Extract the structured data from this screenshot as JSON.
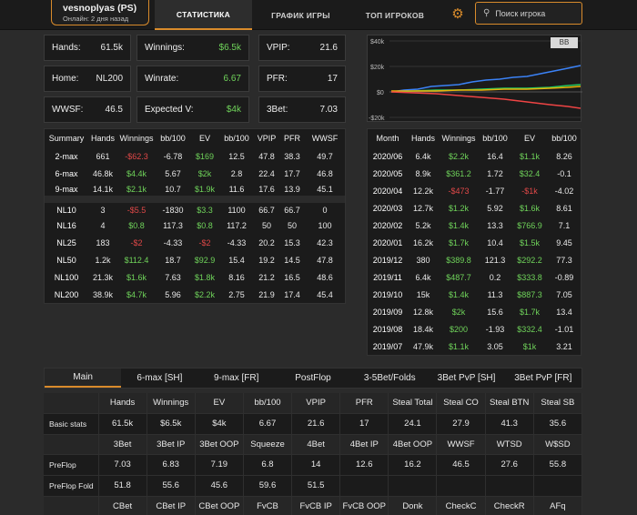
{
  "header": {
    "player_name": "vesnoplyas (PS)",
    "player_status": "Онлайн: 2 дня назад",
    "nav": [
      "СТАТИСТИКА",
      "ГРАФИК ИГРЫ",
      "ТОП ИГРОКОВ"
    ],
    "search_placeholder": "Поиск игрока"
  },
  "stats": [
    {
      "label": "Hands:",
      "value": "61.5k"
    },
    {
      "label": "Winnings:",
      "value": "$6.5k",
      "color": "#6fd35a"
    },
    {
      "label": "VPIP:",
      "value": "21.6"
    },
    {
      "label": "Home:",
      "value": "NL200"
    },
    {
      "label": "Winrate:",
      "value": "6.67",
      "color": "#6fd35a"
    },
    {
      "label": "PFR:",
      "value": "17"
    },
    {
      "label": "WWSF:",
      "value": "46.5"
    },
    {
      "label": "Expected V:",
      "value": "$4k",
      "color": "#6fd35a"
    },
    {
      "label": "3Bet:",
      "value": "7.03"
    }
  ],
  "graph": {
    "unit_toggle": "BB",
    "y_labels": [
      "$40k",
      "$20k",
      "$0",
      "-$20k"
    ]
  },
  "summary": {
    "headers": [
      "Summary",
      "Hands",
      "Winnings",
      "bb/100",
      "EV",
      "bb/100",
      "VPIP",
      "PFR",
      "WWSF"
    ],
    "rows": [
      [
        "2-max",
        "661",
        "-$62.3",
        "-6.78",
        "$169",
        "12.5",
        "47.8",
        "38.3",
        "49.7"
      ],
      [
        "6-max",
        "46.8k",
        "$4.4k",
        "5.67",
        "$2k",
        "2.8",
        "22.4",
        "17.7",
        "46.8"
      ],
      [
        "9-max",
        "14.1k",
        "$2.1k",
        "10.7",
        "$1.9k",
        "11.6",
        "17.6",
        "13.9",
        "45.1"
      ],
      [
        "NL10",
        "3",
        "-$5.5",
        "-1830",
        "$3.3",
        "1100",
        "66.7",
        "66.7",
        "0"
      ],
      [
        "NL16",
        "4",
        "$0.8",
        "117.3",
        "$0.8",
        "117.2",
        "50",
        "50",
        "100"
      ],
      [
        "NL25",
        "183",
        "-$2",
        "-4.33",
        "-$2",
        "-4.33",
        "20.2",
        "15.3",
        "42.3"
      ],
      [
        "NL50",
        "1.2k",
        "$112.4",
        "18.7",
        "$92.9",
        "15.4",
        "19.2",
        "14.5",
        "47.8"
      ],
      [
        "NL100",
        "21.3k",
        "$1.6k",
        "7.63",
        "$1.8k",
        "8.16",
        "21.2",
        "16.5",
        "48.6"
      ],
      [
        "NL200",
        "38.9k",
        "$4.7k",
        "5.96",
        "$2.2k",
        "2.75",
        "21.9",
        "17.4",
        "45.4"
      ]
    ]
  },
  "months": {
    "headers": [
      "Month",
      "Hands",
      "Winnings",
      "bb/100",
      "EV",
      "bb/100"
    ],
    "rows": [
      [
        "2020/06",
        "6.4k",
        "$2.2k",
        "16.4",
        "$1.1k",
        "8.26"
      ],
      [
        "2020/05",
        "8.9k",
        "$361.2",
        "1.72",
        "$32.4",
        "-0.1"
      ],
      [
        "2020/04",
        "12.2k",
        "-$473",
        "-1.77",
        "-$1k",
        "-4.02"
      ],
      [
        "2020/03",
        "12.7k",
        "$1.2k",
        "5.92",
        "$1.6k",
        "8.61"
      ],
      [
        "2020/02",
        "5.2k",
        "$1.4k",
        "13.3",
        "$766.9",
        "7.1"
      ],
      [
        "2020/01",
        "16.2k",
        "$1.7k",
        "10.4",
        "$1.5k",
        "9.45"
      ],
      [
        "2019/12",
        "380",
        "$389.8",
        "121.3",
        "$292.2",
        "77.3"
      ],
      [
        "2019/11",
        "6.4k",
        "$487.7",
        "0.2",
        "$333.8",
        "-0.89"
      ],
      [
        "2019/10",
        "15k",
        "$1.4k",
        "11.3",
        "$887.3",
        "7.05"
      ],
      [
        "2019/09",
        "12.8k",
        "$2k",
        "15.6",
        "$1.7k",
        "13.4"
      ],
      [
        "2019/08",
        "18.4k",
        "$200",
        "-1.93",
        "$332.4",
        "-1.01"
      ],
      [
        "2019/07",
        "47.9k",
        "$1.1k",
        "3.05",
        "$1k",
        "3.21"
      ]
    ]
  },
  "tabs": [
    "Main",
    "6-max [SH]",
    "9-max [FR]",
    "PostFlop",
    "3-5Bet/Folds",
    "3Bet PvP [SH]",
    "3Bet PvP [FR]"
  ],
  "grid": {
    "rows": [
      {
        "type": "hdr",
        "cells": [
          "",
          "Hands",
          "Winnings",
          "EV",
          "bb/100",
          "VPIP",
          "PFR",
          "Steal Total",
          "Steal CO",
          "Steal BTN",
          "Steal SB"
        ]
      },
      {
        "type": "val",
        "cells": [
          "Basic stats",
          "61.5k",
          "$6.5k",
          "$4k",
          "6.67",
          "21.6",
          "17",
          "24.1",
          "27.9",
          "41.3",
          "35.6"
        ]
      },
      {
        "type": "hdr",
        "cells": [
          "",
          "3Bet",
          "3Bet IP",
          "3Bet OOP",
          "Squeeze",
          "4Bet",
          "4Bet IP",
          "4Bet OOP",
          "WWSF",
          "WTSD",
          "W$SD"
        ]
      },
      {
        "type": "val",
        "cells": [
          "PreFlop",
          "7.03",
          "6.83",
          "7.19",
          "6.8",
          "14",
          "12.6",
          "16.2",
          "46.5",
          "27.6",
          "55.8"
        ]
      },
      {
        "type": "val",
        "cells": [
          "PreFlop Fold",
          "51.8",
          "55.6",
          "45.6",
          "59.6",
          "51.5",
          "",
          "",
          "",
          "",
          ""
        ]
      },
      {
        "type": "hdr",
        "cells": [
          "",
          "CBet",
          "CBet IP",
          "CBet OOP",
          "FvCB",
          "FvCB IP",
          "FvCB OOP",
          "Donk",
          "CheckC",
          "CheckR",
          "AFq"
        ]
      }
    ]
  }
}
